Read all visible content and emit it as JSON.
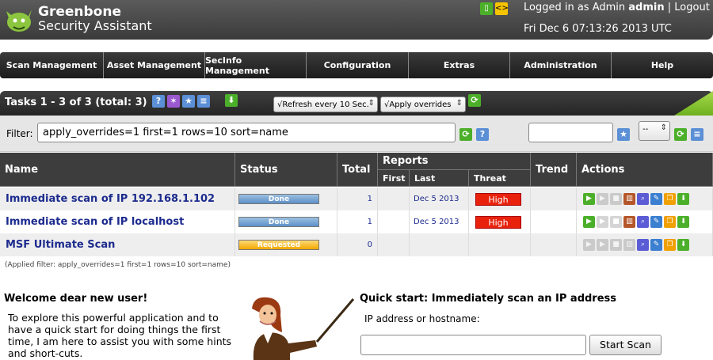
{
  "app": {
    "logo_line1": "Greenbone",
    "logo_line2": "Security Assistant",
    "login_prefix": "Logged in as Admin",
    "login_user": "admin",
    "logout_label": "Logout",
    "separator": "|",
    "datetime": "Fri Dec 6 07:13:26 2013 UTC"
  },
  "nav": [
    "Scan Management",
    "Asset Management",
    "SecInfo Management",
    "Configuration",
    "Extras",
    "Administration",
    "Help"
  ],
  "section": {
    "title": "Tasks 1 - 3 of 3 (total: 3)",
    "refresh_select": "√Refresh every 10 Sec.",
    "overrides_select": "√Apply overrides"
  },
  "filter": {
    "label": "Filter:",
    "value": "apply_overrides=1 first=1 rows=10 sort=name",
    "name_value": "",
    "dropdown_value": "--"
  },
  "table": {
    "headers": {
      "name": "Name",
      "status": "Status",
      "total": "Total",
      "reports": "Reports",
      "first": "First",
      "last": "Last",
      "threat": "Threat",
      "trend": "Trend",
      "actions": "Actions"
    },
    "rows": [
      {
        "name": "Immediate scan of IP 192.168.1.102",
        "status": "Done",
        "status_kind": "done",
        "total": "1",
        "first": "",
        "last": "Dec 5 2013",
        "threat": "High"
      },
      {
        "name": "Immediate scan of IP localhost",
        "status": "Done",
        "status_kind": "done",
        "total": "1",
        "first": "",
        "last": "Dec 5 2013",
        "threat": "High"
      },
      {
        "name": "MSF Ultimate Scan",
        "status": "Requested",
        "status_kind": "requested",
        "total": "0",
        "first": "",
        "last": "",
        "threat": ""
      }
    ],
    "applied_filter": "(Applied filter: apply_overrides=1 first=1 rows=10 sort=name)"
  },
  "welcome": {
    "title": "Welcome dear new user!",
    "text": "To explore this powerful application and to have a quick start for doing things the first time, I am here to assist you with some hints and short-cuts."
  },
  "quickstart": {
    "title": "Quick start: Immediately scan an IP address",
    "label": "IP address or hostname:",
    "input_value": "",
    "button": "Start Scan"
  },
  "colors": {
    "header_bg": "#3a3a3a",
    "link": "#1c2b8e",
    "threat_high": "#e8220c",
    "done_bar": "#5d90c8",
    "requested_bar": "#f2a800",
    "accent_green": "#6fb01e"
  }
}
